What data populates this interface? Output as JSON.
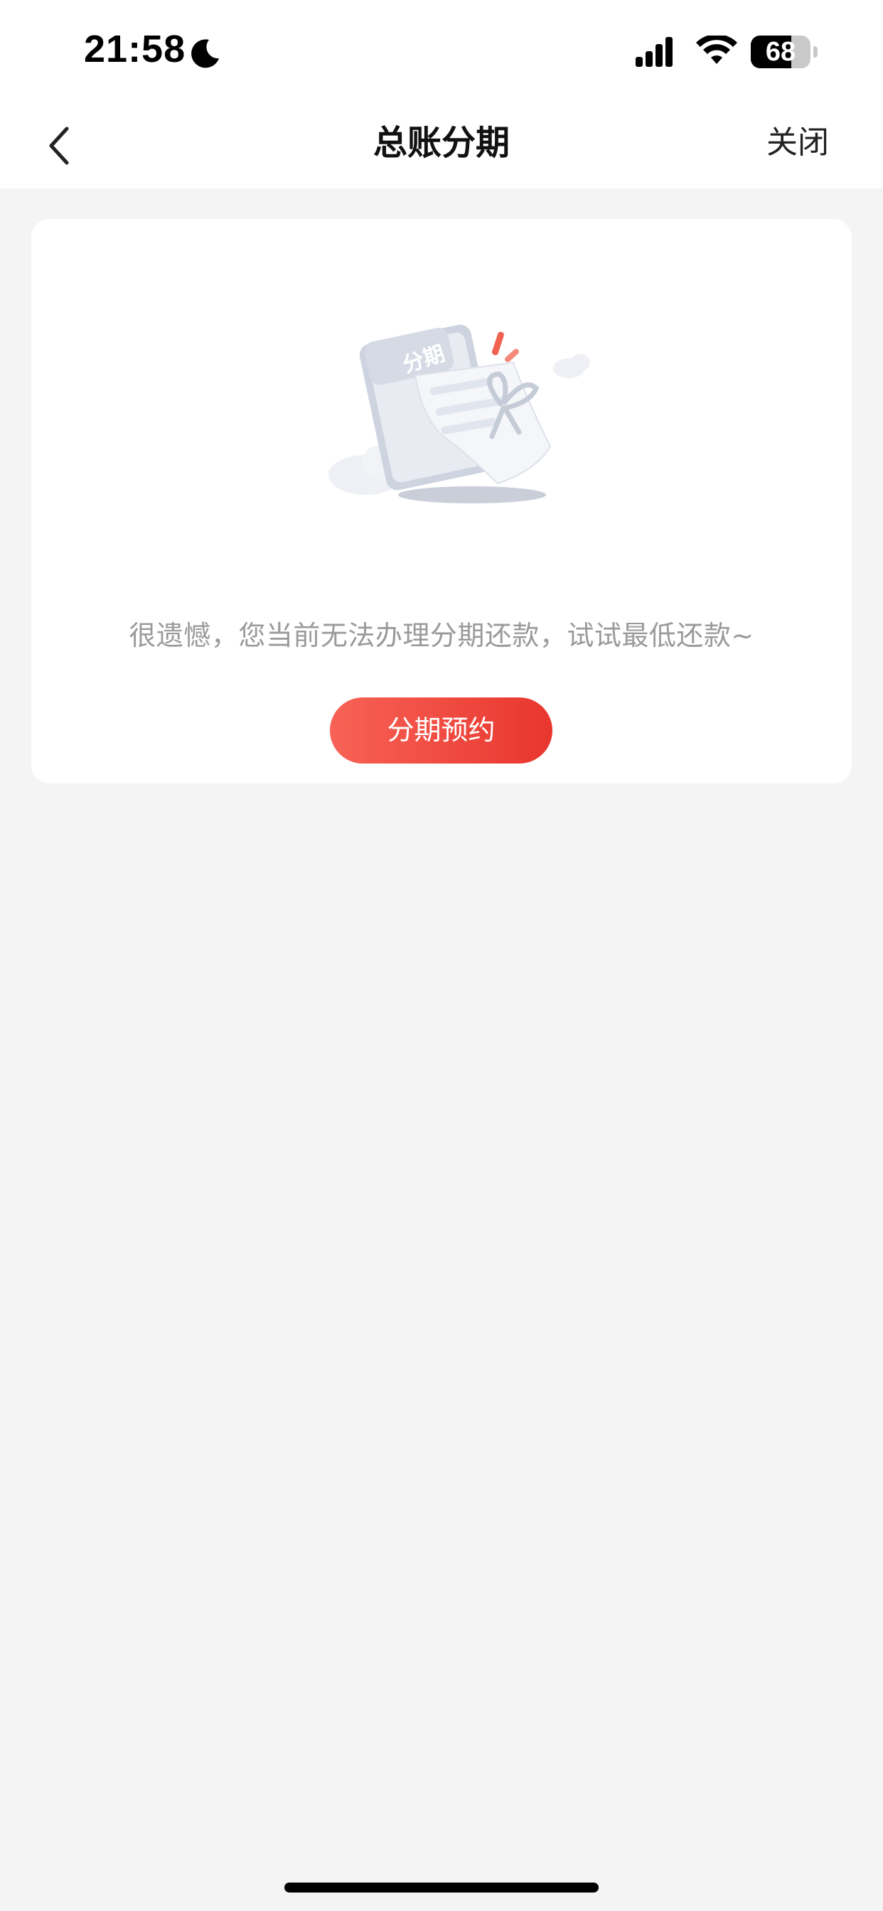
{
  "status_bar": {
    "time": "21:58",
    "battery_percent": "68",
    "battery_level": 0.68,
    "icons": [
      "moon-icon",
      "signal-icon",
      "wifi-icon",
      "battery-icon"
    ]
  },
  "nav": {
    "back_icon": "chevron-left-icon",
    "title": "总账分期",
    "close_label": "关闭"
  },
  "card": {
    "illustration_label": "分期",
    "message": "很遗憾，您当前无法办理分期还款，试试最低还款~",
    "button_label": "分期预约"
  },
  "colors": {
    "accent_start": "#f86256",
    "accent_end": "#e8362e",
    "page_background": "#f4f4f4",
    "message_text": "#9a9a9a"
  }
}
